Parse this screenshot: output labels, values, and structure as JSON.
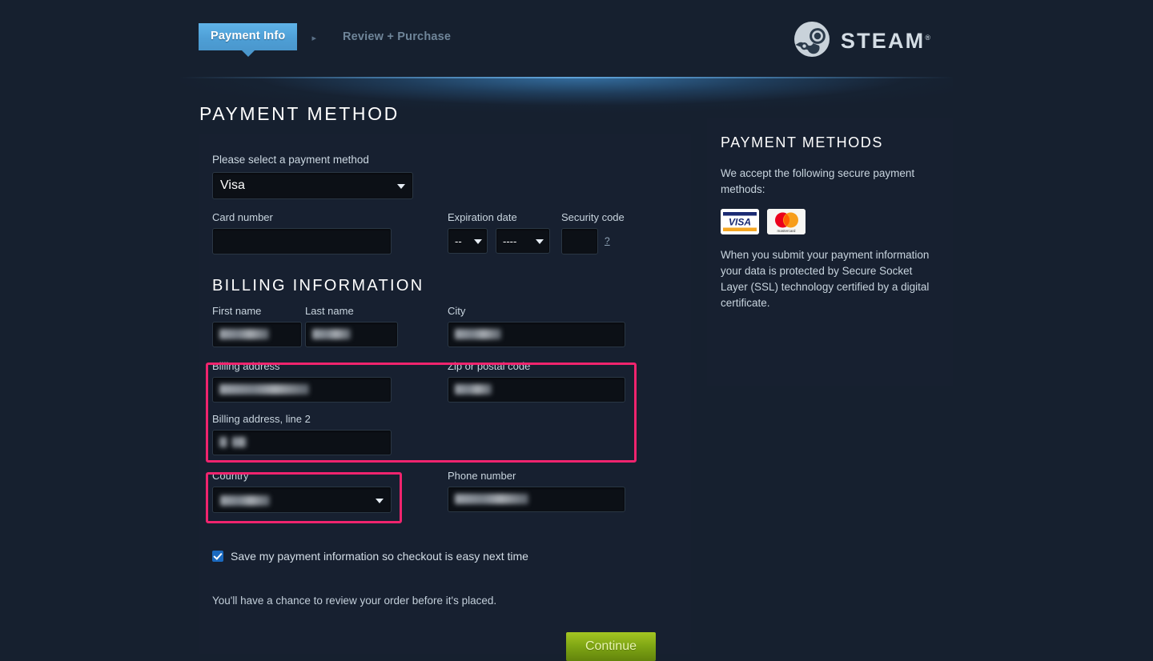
{
  "header": {
    "tabs": [
      {
        "label": "Payment Info",
        "state": "active"
      },
      {
        "label": "Review + Purchase",
        "state": "inactive"
      }
    ],
    "separator": "▸",
    "logo": {
      "wordmark": "STEAM",
      "registered": "®",
      "icon": "steam-logo-icon"
    }
  },
  "main": {
    "page_title": "PAYMENT METHOD",
    "payment_select": {
      "label": "Please select a payment method",
      "value": "Visa",
      "caret_icon": "chevron-down-icon"
    },
    "card_number": {
      "label": "Card number",
      "value": "",
      "placeholder": ""
    },
    "expiration": {
      "label": "Expiration date",
      "month_value": "--",
      "year_value": "----"
    },
    "security_code": {
      "label": "Security code",
      "value": "",
      "help": "?"
    },
    "billing_section_title": "BILLING INFORMATION",
    "first_name": {
      "label": "First name",
      "value": "",
      "redacted": true
    },
    "last_name": {
      "label": "Last name",
      "value": "",
      "redacted": true
    },
    "city": {
      "label": "City",
      "value": "",
      "redacted": true
    },
    "billing_address": {
      "label": "Billing address",
      "value": "",
      "redacted": true
    },
    "billing_address2": {
      "label": "Billing address, line 2",
      "value": "",
      "redacted": true
    },
    "zip": {
      "label": "Zip or postal code",
      "value": "",
      "redacted": true
    },
    "country": {
      "label": "Country",
      "value": "",
      "redacted": true,
      "caret_icon": "chevron-down-icon"
    },
    "phone": {
      "label": "Phone number",
      "value": "",
      "redacted": true
    },
    "save_checkbox": {
      "label": "Save my payment information so checkout is easy next time",
      "checked": true
    },
    "review_note": "You'll have a chance to review your order before it's placed.",
    "continue_button": "Continue"
  },
  "sidebar": {
    "title": "PAYMENT METHODS",
    "accept_text": "We accept the following secure payment methods:",
    "card_logos": [
      {
        "name": "visa-logo",
        "label": "VISA"
      },
      {
        "name": "mastercard-logo",
        "label": "mastercard"
      }
    ],
    "ssl_text": "When you submit your payment information your data is protected by Secure Socket Layer (SSL) technology certified by a digital certificate."
  },
  "colors": {
    "page_background": "#16202f",
    "panel_background": "#172030",
    "accent_tab": "#4e9fd6",
    "highlight_box": "#f0246e",
    "continue_button": "#7fa614",
    "input_background": "#0c1016"
  }
}
